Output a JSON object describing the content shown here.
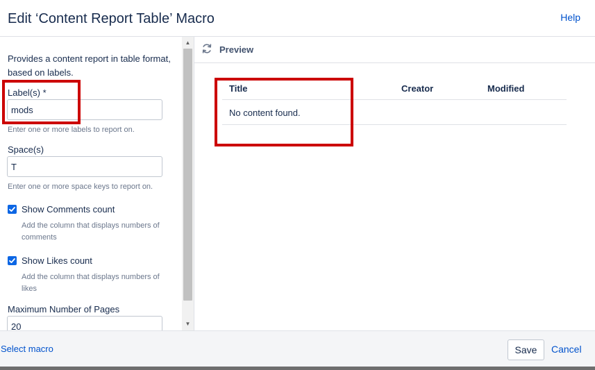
{
  "header": {
    "title": "Edit ‘Content Report Table’ Macro",
    "help_label": "Help"
  },
  "form": {
    "description": "Provides a content report in table format, based on labels.",
    "labels": {
      "label": "Label(s) *",
      "value": "mods",
      "hint": "Enter one or more labels to report on."
    },
    "spaces": {
      "label": "Space(s)",
      "value": "T",
      "hint": "Enter one or more space keys to report on."
    },
    "show_comments": {
      "label": "Show Comments count",
      "checked": true,
      "hint": "Add the column that displays numbers of comments"
    },
    "show_likes": {
      "label": "Show Likes count",
      "checked": true,
      "hint": "Add the column that displays numbers of likes"
    },
    "max_pages": {
      "label": "Maximum Number of Pages",
      "value": "20"
    }
  },
  "preview": {
    "label": "Preview",
    "columns": [
      "Title",
      "Creator",
      "Modified"
    ],
    "empty_message": "No content found."
  },
  "footer": {
    "select_macro_label": "Select macro",
    "save_label": "Save",
    "cancel_label": "Cancel"
  },
  "colors": {
    "accent": "#0052cc",
    "checkbox": "#0c66e4",
    "highlight": "#cc0000"
  },
  "icons": {
    "preview": "refresh-icon",
    "checkbox": "check-icon"
  }
}
